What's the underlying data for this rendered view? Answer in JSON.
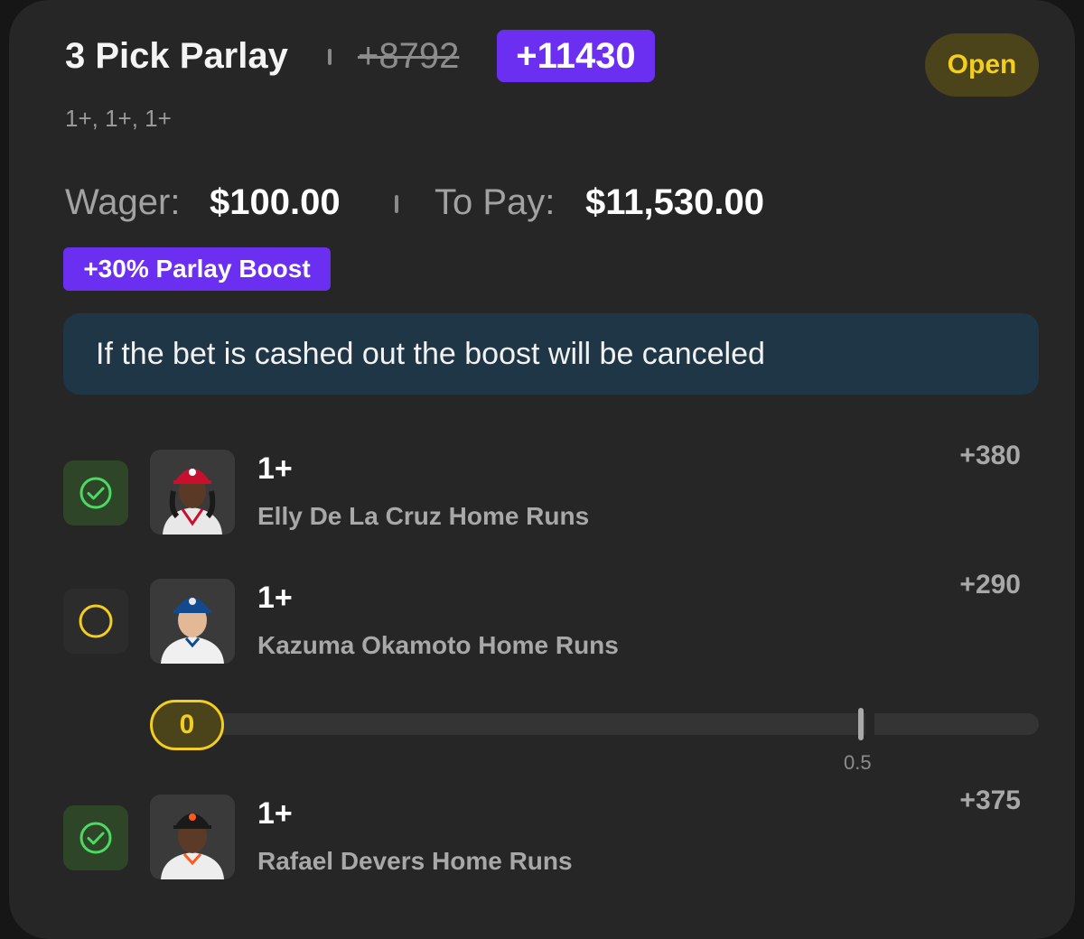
{
  "bet": {
    "title": "3 Pick Parlay",
    "original_odds": "+8792",
    "boosted_odds": "+11430",
    "status": "Open",
    "legs_summary": "1+, 1+, 1+",
    "wager_label": "Wager:",
    "wager_value": "$100.00",
    "to_pay_label": "To Pay:",
    "to_pay_value": "$11,530.00",
    "boost_badge": "+30% Parlay Boost",
    "notice": "If the bet is cashed out the boost will be canceled"
  },
  "legs": [
    {
      "line": "1+",
      "player": "Elly De La Cruz Home Runs",
      "odds": "+380",
      "status": "won",
      "status_icon": "check-circle-icon",
      "cap_color": "#c8102e",
      "jersey_color": "#e8e8e8"
    },
    {
      "line": "1+",
      "player": "Kazuma Okamoto Home Runs",
      "odds": "+290",
      "status": "open",
      "status_icon": "empty-circle-icon",
      "cap_color": "#134a8e",
      "jersey_color": "#f0f0f0"
    },
    {
      "line": "1+",
      "player": "Rafael Devers Home Runs",
      "odds": "+375",
      "status": "won",
      "status_icon": "check-circle-icon",
      "cap_color": "#1a1a1a",
      "jersey_color": "#ededed"
    }
  ],
  "progress": {
    "current": "0",
    "target": "0.5",
    "fraction": 0
  },
  "colors": {
    "purple": "#6b2ff2",
    "open_yellow": "#f2ce20",
    "won_green": "#4cd964",
    "notice_bg": "#1f3646"
  }
}
